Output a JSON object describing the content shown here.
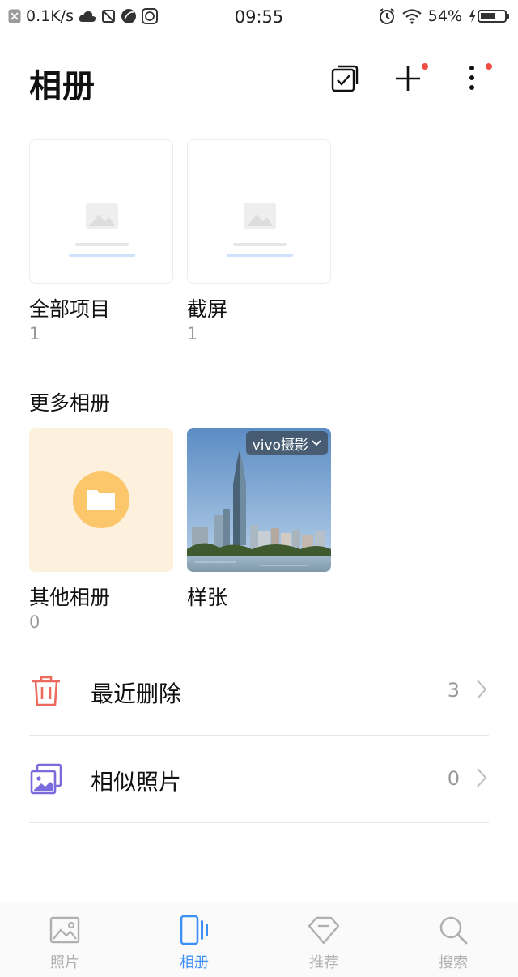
{
  "status_bar": {
    "net_speed": "0.1K/s",
    "time": "09:55",
    "battery": "54%"
  },
  "header": {
    "title": "相册"
  },
  "albums": [
    {
      "name": "全部项目",
      "count": "1"
    },
    {
      "name": "截屏",
      "count": "1"
    }
  ],
  "more_albums": {
    "section_title": "更多相册",
    "items": [
      {
        "name": "其他相册",
        "count": "0"
      },
      {
        "name": "样张",
        "count": "",
        "badge": "vivo摄影"
      }
    ]
  },
  "more_albums_count_sample": "",
  "list": [
    {
      "label": "最近删除",
      "count": "3",
      "icon": "trash-icon",
      "color": "#ec6b5e"
    },
    {
      "label": "相似照片",
      "count": "0",
      "icon": "similar-photos-icon",
      "color": "#7a6bdc"
    }
  ],
  "bottom_nav": [
    {
      "label": "照片",
      "icon": "photo-icon",
      "active": false
    },
    {
      "label": "相册",
      "icon": "album-icon",
      "active": true
    },
    {
      "label": "推荐",
      "icon": "diamond-icon",
      "active": false
    },
    {
      "label": "搜索",
      "icon": "search-icon",
      "active": false
    }
  ],
  "colors": {
    "accent": "#3d8ff5",
    "notification_dot": "#f04e45",
    "folder_bg": "#fdf0dd",
    "folder_circle": "#fbc76a"
  }
}
